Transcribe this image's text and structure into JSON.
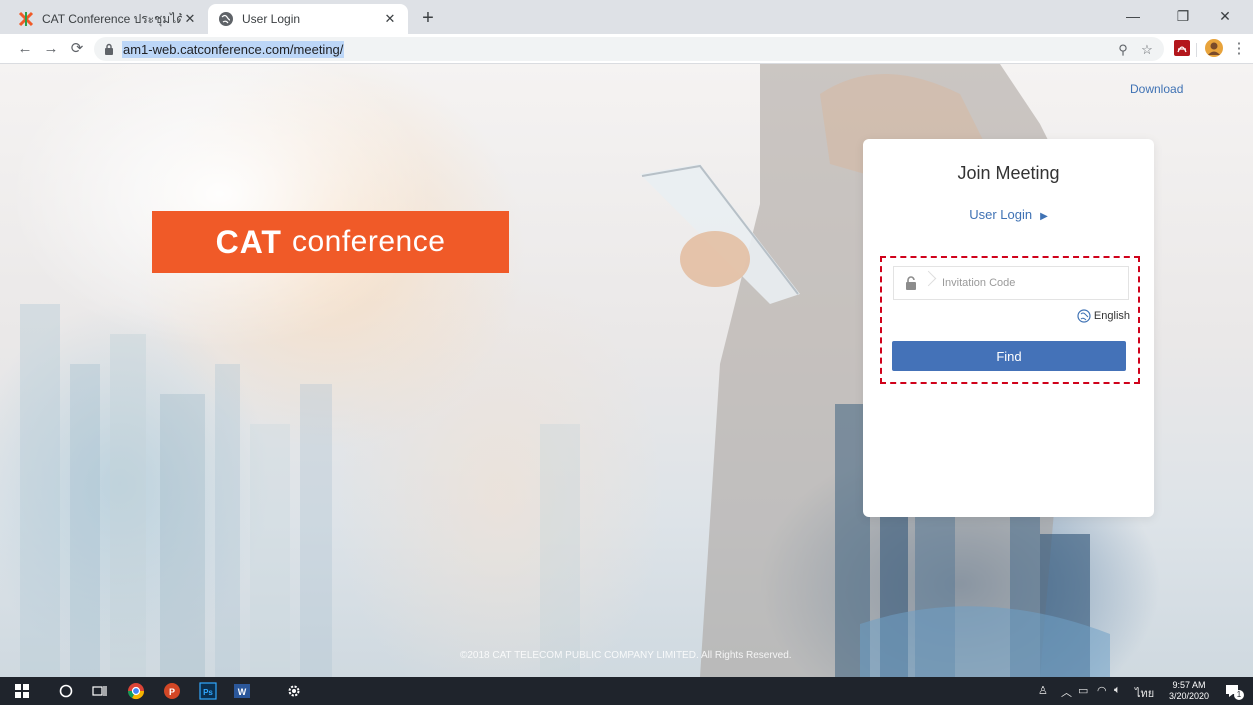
{
  "browser": {
    "tabs": [
      {
        "title": "CAT Conference ประชุมได้ไร้ขีดจำกัด",
        "active": false
      },
      {
        "title": "User Login",
        "active": true
      }
    ],
    "url": "am1-web.catconference.com/meeting/"
  },
  "page": {
    "brand": {
      "logo_text": "CAT",
      "word": "conference"
    },
    "download_label": "Download",
    "panel": {
      "title": "Join Meeting",
      "user_login_label": "User Login",
      "invitation_placeholder": "Invitation Code",
      "language_label": "English",
      "find_label": "Find"
    },
    "copyright": "©2018 CAT TELECOM PUBLIC COMPANY LIMITED. All Rights Reserved."
  },
  "taskbar": {
    "language": "ไทย",
    "time": "9:57 AM",
    "date": "3/20/2020",
    "notification_count": "1"
  },
  "colors": {
    "brand_orange": "#f05a28",
    "button_blue": "#4472b8",
    "link_blue": "#3f72b4",
    "highlight_red": "#d0021b"
  }
}
